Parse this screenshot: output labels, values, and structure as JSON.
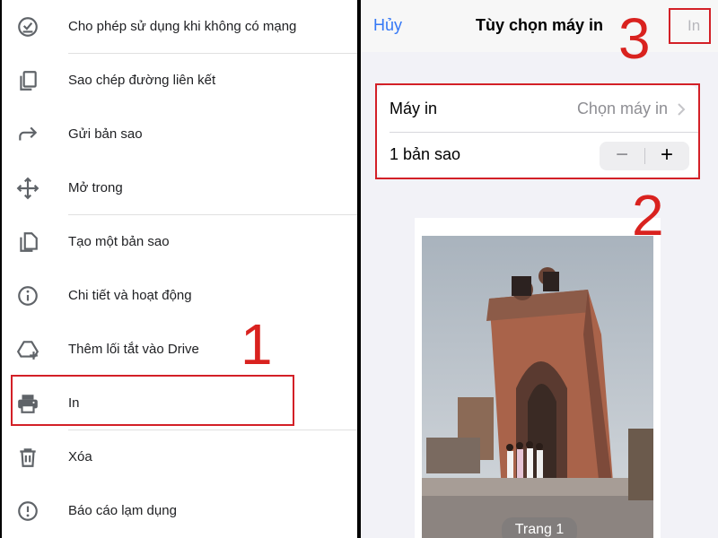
{
  "left_menu": {
    "items": [
      {
        "label": "Cho phép sử dụng khi không có mạng",
        "icon": "offline-check-icon"
      },
      {
        "label": "Sao chép đường liên kết",
        "icon": "copy-link-icon"
      },
      {
        "label": "Gửi bản sao",
        "icon": "send-arrow-icon"
      },
      {
        "label": "Mở trong",
        "icon": "move-arrows-icon"
      },
      {
        "label": "Tạo một bản sao",
        "icon": "file-copy-icon"
      },
      {
        "label": "Chi tiết và hoạt động",
        "icon": "info-icon"
      },
      {
        "label": "Thêm lối tắt vào Drive",
        "icon": "drive-shortcut-icon"
      },
      {
        "label": "In",
        "icon": "printer-icon"
      },
      {
        "label": "Xóa",
        "icon": "trash-icon"
      },
      {
        "label": "Báo cáo lạm dụng",
        "icon": "report-icon"
      }
    ]
  },
  "print_options": {
    "cancel_label": "Hủy",
    "title": "Tùy chọn máy in",
    "print_label": "In",
    "printer_label": "Máy in",
    "printer_value": "Chọn máy in",
    "copies_label": "1 bản sao",
    "minus": "−",
    "plus": "+",
    "page_badge": "Trang 1"
  },
  "annotations": {
    "step1": "1",
    "step2": "2",
    "step3": "3",
    "color": "#d9221f"
  }
}
